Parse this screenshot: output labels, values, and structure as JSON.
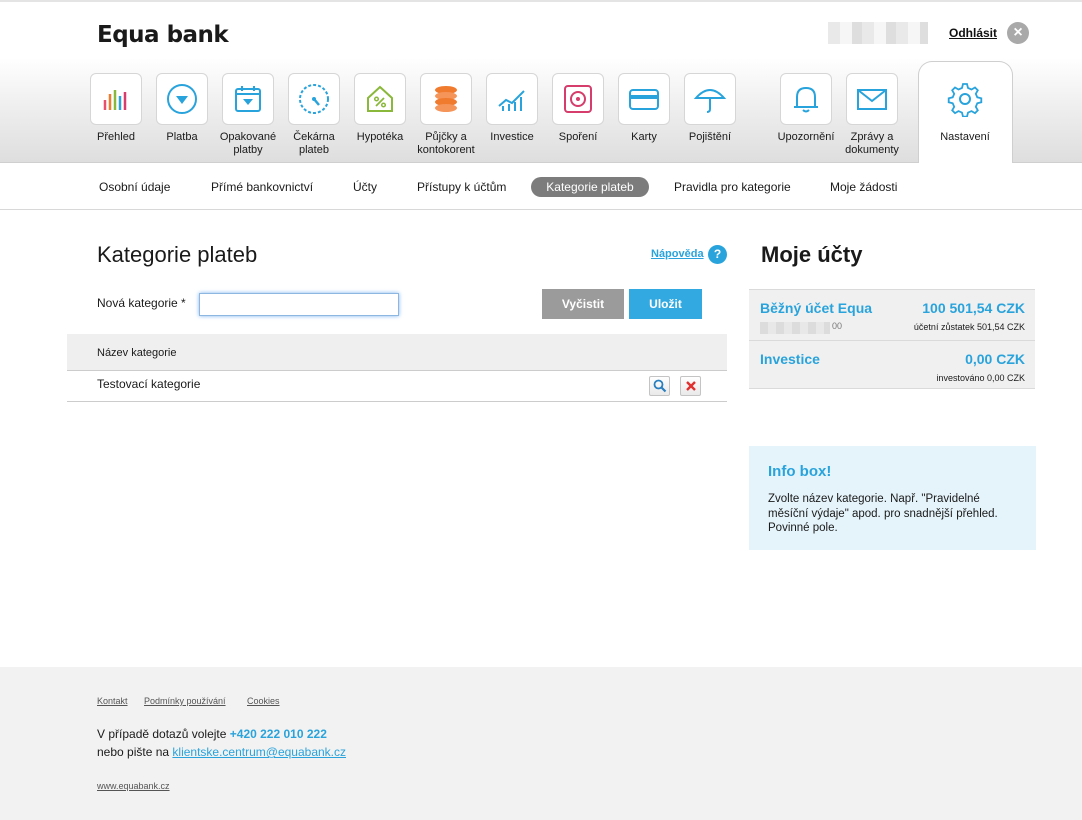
{
  "header": {
    "brand": "Equa bank",
    "logout_label": "Odhlásit",
    "close_symbol": "×"
  },
  "nav": {
    "items": [
      {
        "label": "Přehled",
        "icon": "bar-chart-icon",
        "color": "#e94f6a"
      },
      {
        "label": "Platba",
        "icon": "payment-arrow-icon",
        "color": "#29a3dc"
      },
      {
        "label": "Opakované platby",
        "icon": "calendar-icon",
        "color": "#29a3dc"
      },
      {
        "label": "Čekárna plateb",
        "icon": "gauge-icon",
        "color": "#29a3dc"
      },
      {
        "label": "Hypotéka",
        "icon": "house-percent-icon",
        "color": "#8ab83a"
      },
      {
        "label": "Půjčky a kontokorent",
        "icon": "coins-icon",
        "color": "#f07b2e"
      },
      {
        "label": "Investice",
        "icon": "growth-chart-icon",
        "color": "#29a3dc"
      },
      {
        "label": "Spoření",
        "icon": "safe-icon",
        "color": "#d63c6c"
      },
      {
        "label": "Karty",
        "icon": "card-icon",
        "color": "#29a3dc"
      },
      {
        "label": "Pojištění",
        "icon": "umbrella-icon",
        "color": "#29a3dc"
      },
      {
        "label": "Upozornění",
        "icon": "bell-icon",
        "color": "#29a3dc"
      },
      {
        "label": "Zprávy a dokumenty",
        "icon": "envelope-icon",
        "color": "#29a3dc"
      },
      {
        "label": "Nastavení",
        "icon": "gear-icon",
        "color": "#29a3dc"
      }
    ]
  },
  "subnav": {
    "items": [
      "Osobní údaje",
      "Přímé bankovnictví",
      "Účty",
      "Přístupy k účtům",
      "Kategorie plateb",
      "Pravidla pro kategorie",
      "Moje žádosti"
    ],
    "active": "Kategorie plateb"
  },
  "main": {
    "title": "Kategorie plateb",
    "help_label": "Nápověda",
    "help_symbol": "?",
    "field_label": "Nová kategorie *",
    "field_value": "",
    "clear_label": "Vyčistit",
    "save_label": "Uložit",
    "table": {
      "header": "Název kategorie",
      "rows": [
        "Testovací kategorie"
      ]
    }
  },
  "side": {
    "title": "Moje účty",
    "accounts": [
      {
        "name": "Běžný účet Equa",
        "amount": "100 501,54 CZK",
        "number_tail": "00",
        "sub": "účetní zůstatek 501,54 CZK"
      },
      {
        "name": "Investice",
        "amount": "0,00 CZK",
        "sub": "investováno 0,00 CZK"
      }
    ],
    "infobox": {
      "title": "Info box!",
      "text": "Zvolte název kategorie. Např. \"Pravidelné měsíční výdaje\" apod. pro snadnější přehled. Povinné pole."
    }
  },
  "footer": {
    "links": [
      "Kontakt",
      "Podmínky používání",
      "Cookies"
    ],
    "contact_prefix": "V případě dotazů volejte",
    "phone": "+420 222 010 222",
    "email_prefix": "nebo pište na",
    "email": "klientske.centrum@equabank.cz",
    "website": "www.equabank.cz"
  },
  "colors": {
    "accent": "#29a3dc",
    "button_grey": "#9b9b9b",
    "button_blue": "#32a9e0",
    "infobox_bg": "#e5f4fb"
  }
}
